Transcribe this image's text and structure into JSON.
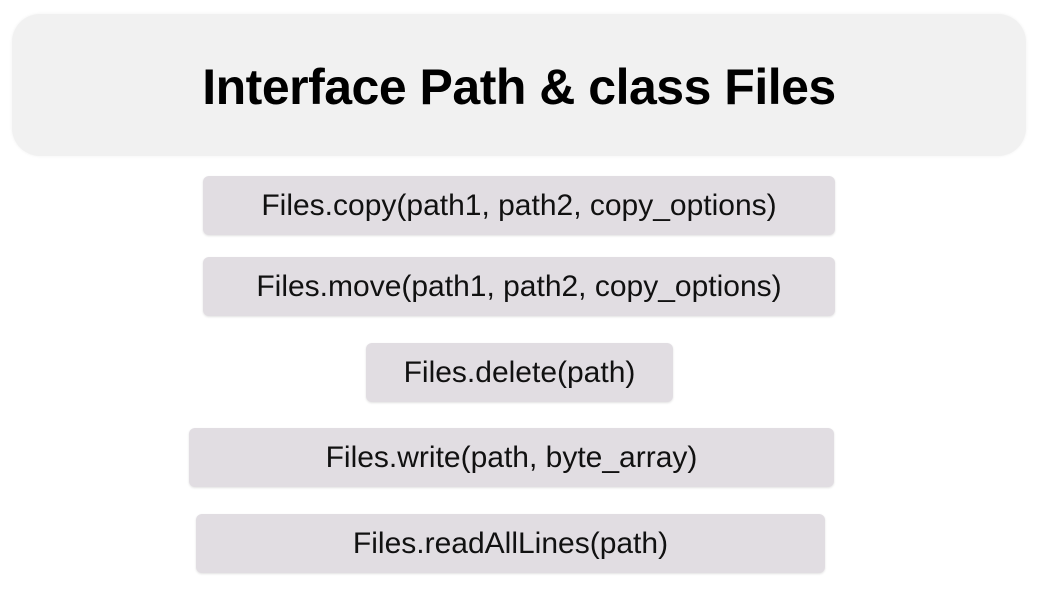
{
  "slide": {
    "title": "Interface Path & class Files",
    "methods": [
      "Files.copy(path1, path2, copy_options)",
      "Files.move(path1, path2, copy_options)",
      "Files.delete(path)",
      "Files.write(path, byte_array)",
      "Files.readAllLines(path)"
    ]
  },
  "colors": {
    "title_box": "#f1f1f1",
    "method_box": "#e1dde2",
    "text": "#000000"
  }
}
